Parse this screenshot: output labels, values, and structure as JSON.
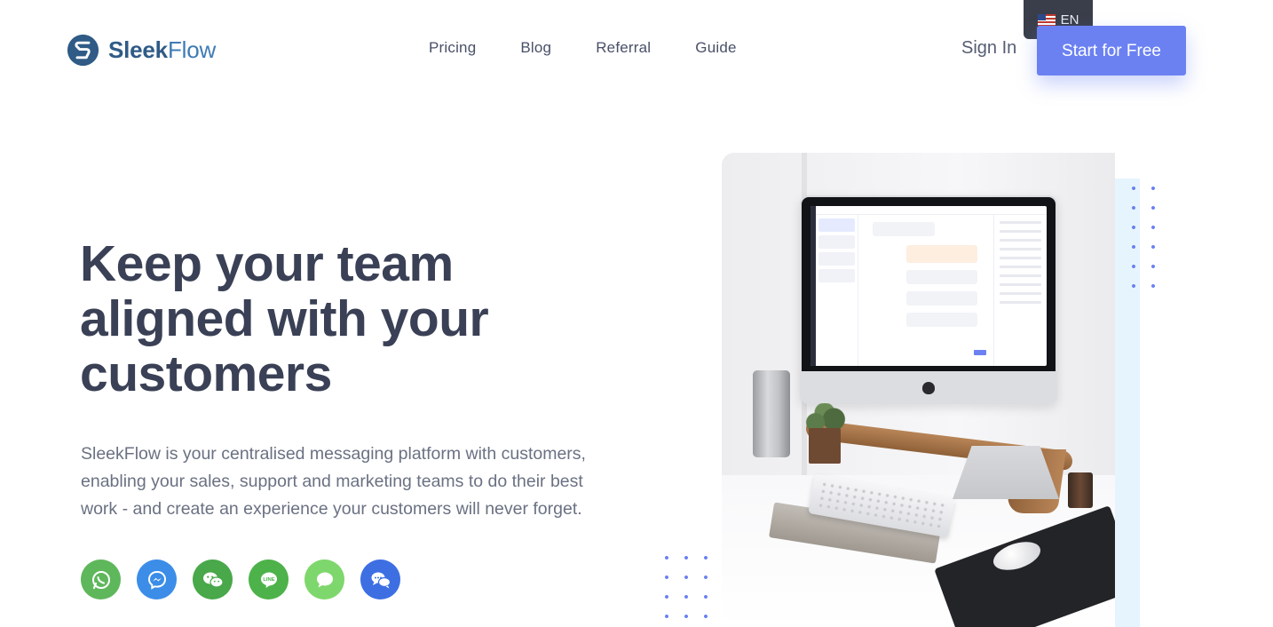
{
  "brand": {
    "name_bold": "Sleek",
    "name_light": "Flow"
  },
  "language": {
    "label": "EN",
    "flag_icon": "us-flag-icon"
  },
  "nav": {
    "items": [
      {
        "label": "Pricing"
      },
      {
        "label": "Blog"
      },
      {
        "label": "Referral"
      },
      {
        "label": "Guide"
      }
    ]
  },
  "auth": {
    "sign_in": "Sign In",
    "cta": "Start for Free"
  },
  "hero": {
    "headline": "Keep your team aligned with your customers",
    "subtext": "SleekFlow is your centralised messaging platform with customers, enabling your sales, support and marketing teams to do their best work - and create an experience your customers will never forget."
  },
  "channels": [
    {
      "name": "whatsapp-icon",
      "color": "#5fb75c"
    },
    {
      "name": "messenger-icon",
      "color": "#3b8de8"
    },
    {
      "name": "wechat-icon",
      "color": "#49a84a"
    },
    {
      "name": "line-icon",
      "color": "#4db24a"
    },
    {
      "name": "sms-icon",
      "color": "#7ed76c"
    },
    {
      "name": "livechat-icon",
      "color": "#3d6fe3"
    }
  ],
  "colors": {
    "accent": "#6b81f2",
    "heading": "#3a4055",
    "body_text": "#6a7182"
  }
}
